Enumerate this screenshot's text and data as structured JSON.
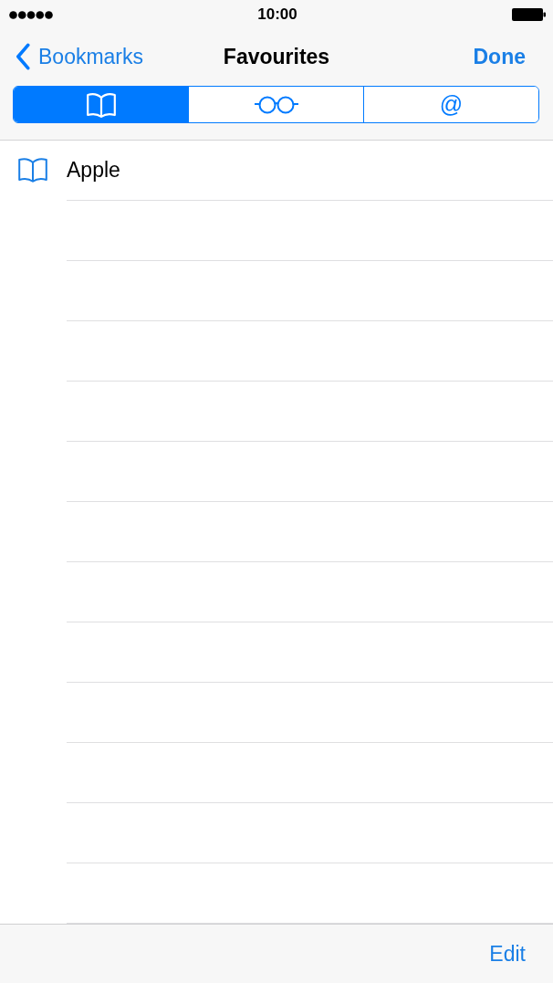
{
  "status_bar": {
    "time": "10:00"
  },
  "nav_bar": {
    "back": "Bookmarks",
    "title": "Favourites",
    "done": "Done"
  },
  "segments": [
    {
      "kind": "book",
      "selected": true
    },
    {
      "kind": "glasses",
      "selected": false
    },
    {
      "kind": "text",
      "label": "@",
      "selected": false
    }
  ],
  "bookmarks": [
    {
      "title": "Apple"
    }
  ],
  "toolbar": {
    "edit": "Edit"
  }
}
